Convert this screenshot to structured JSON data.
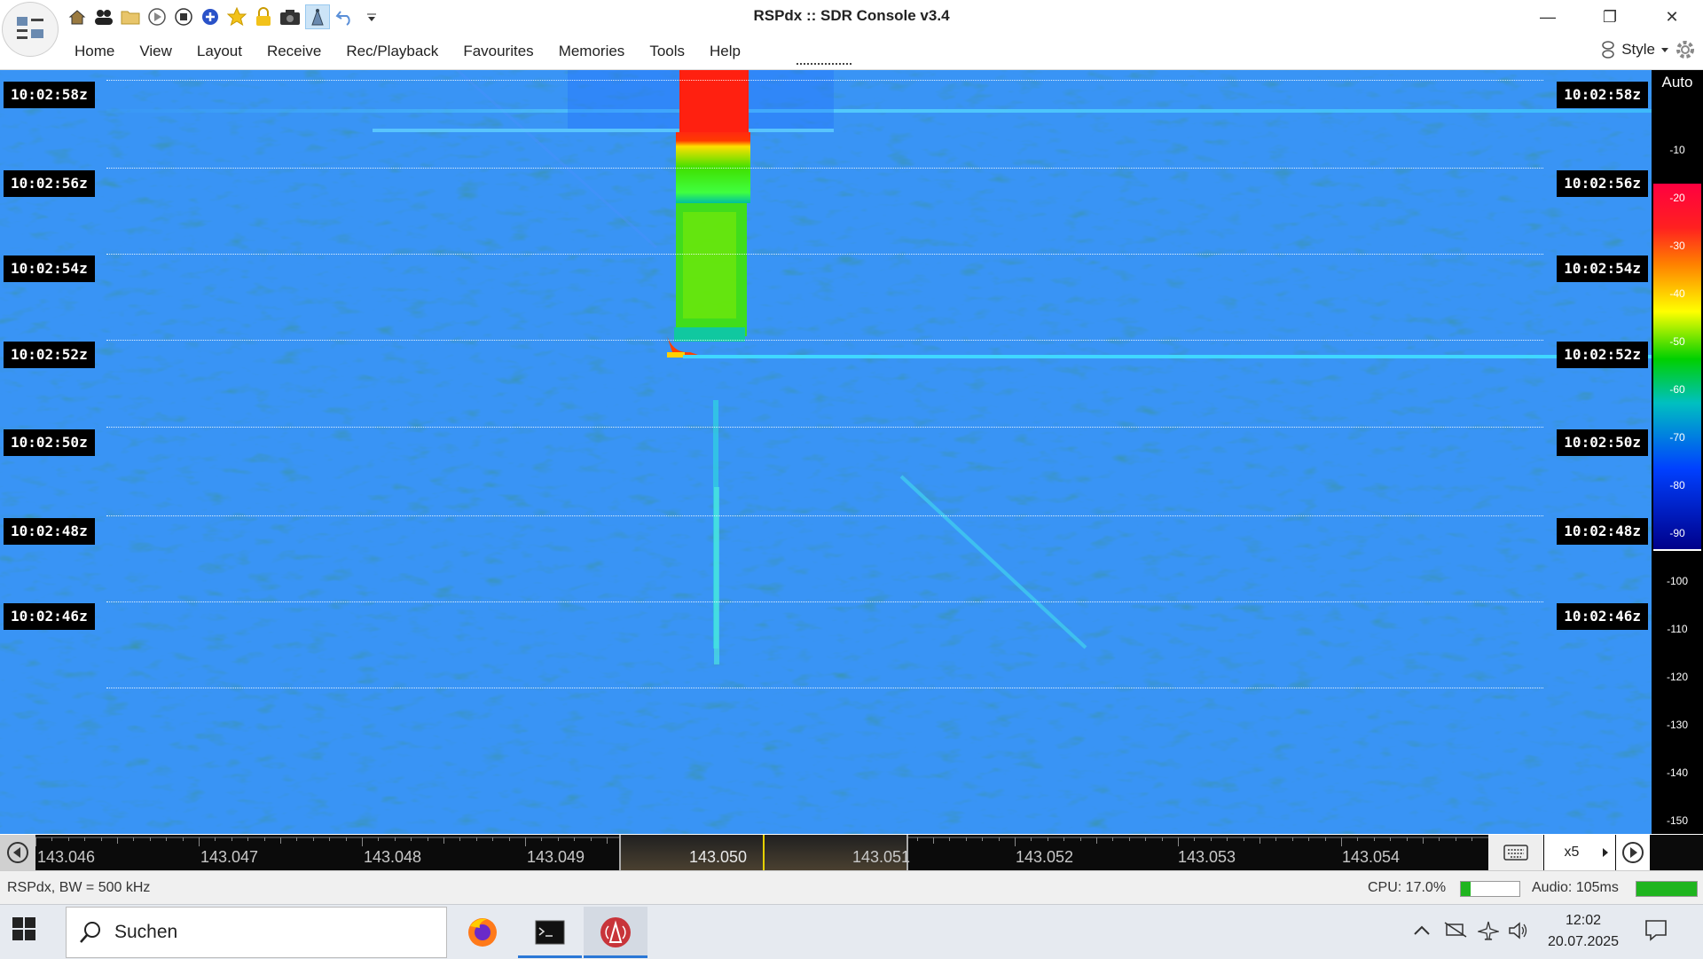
{
  "window": {
    "title": "RSPdx :: SDR Console v3.4",
    "minimize_glyph": "—",
    "restore_glyph": "❐",
    "close_glyph": "✕"
  },
  "quick_access": [
    {
      "name": "home-icon"
    },
    {
      "name": "users-icon"
    },
    {
      "name": "folder-icon"
    },
    {
      "name": "play-icon"
    },
    {
      "name": "stop-icon"
    },
    {
      "name": "add-icon"
    },
    {
      "name": "star-icon"
    },
    {
      "name": "lock-icon"
    },
    {
      "name": "camera-icon"
    },
    {
      "name": "antenna-icon"
    },
    {
      "name": "undo-icon"
    },
    {
      "name": "customize-dropdown-icon"
    }
  ],
  "menu": {
    "items": [
      "Home",
      "View",
      "Layout",
      "Receive",
      "Rec/Playback",
      "Favourites",
      "Memories",
      "Tools",
      "Help"
    ],
    "style_label": "Style"
  },
  "waterfall": {
    "time_labels": [
      "10:02:58z",
      "10:02:56z",
      "10:02:54z",
      "10:02:52z",
      "10:02:50z",
      "10:02:48z",
      "10:02:46z"
    ]
  },
  "color_scale": {
    "mode_label": "Auto",
    "levels": [
      "-10",
      "-20",
      "-30",
      "-40",
      "-50",
      "-60",
      "-70",
      "-80",
      "-90",
      "-100",
      "-110",
      "-120",
      "-130",
      "-140",
      "-150"
    ],
    "colors": {
      "hot": "#ff2020",
      "warm": "#ffff00",
      "mid": "#00d000",
      "cool": "#00c0c0",
      "base": "#0a2a9a"
    }
  },
  "frequency_axis": {
    "labels": [
      "143.046",
      "143.047",
      "143.048",
      "143.049",
      "143.050",
      "143.051",
      "143.052",
      "143.053",
      "143.054"
    ],
    "zoom": "x5"
  },
  "status": {
    "device": "RSPdx, BW = 500 kHz",
    "cpu": "CPU: 17.0%",
    "cpu_level": 0.17,
    "audio": "Audio: 105ms"
  },
  "taskbar": {
    "search_placeholder": "Suchen",
    "time": "12:02",
    "date": "20.07.2025"
  }
}
